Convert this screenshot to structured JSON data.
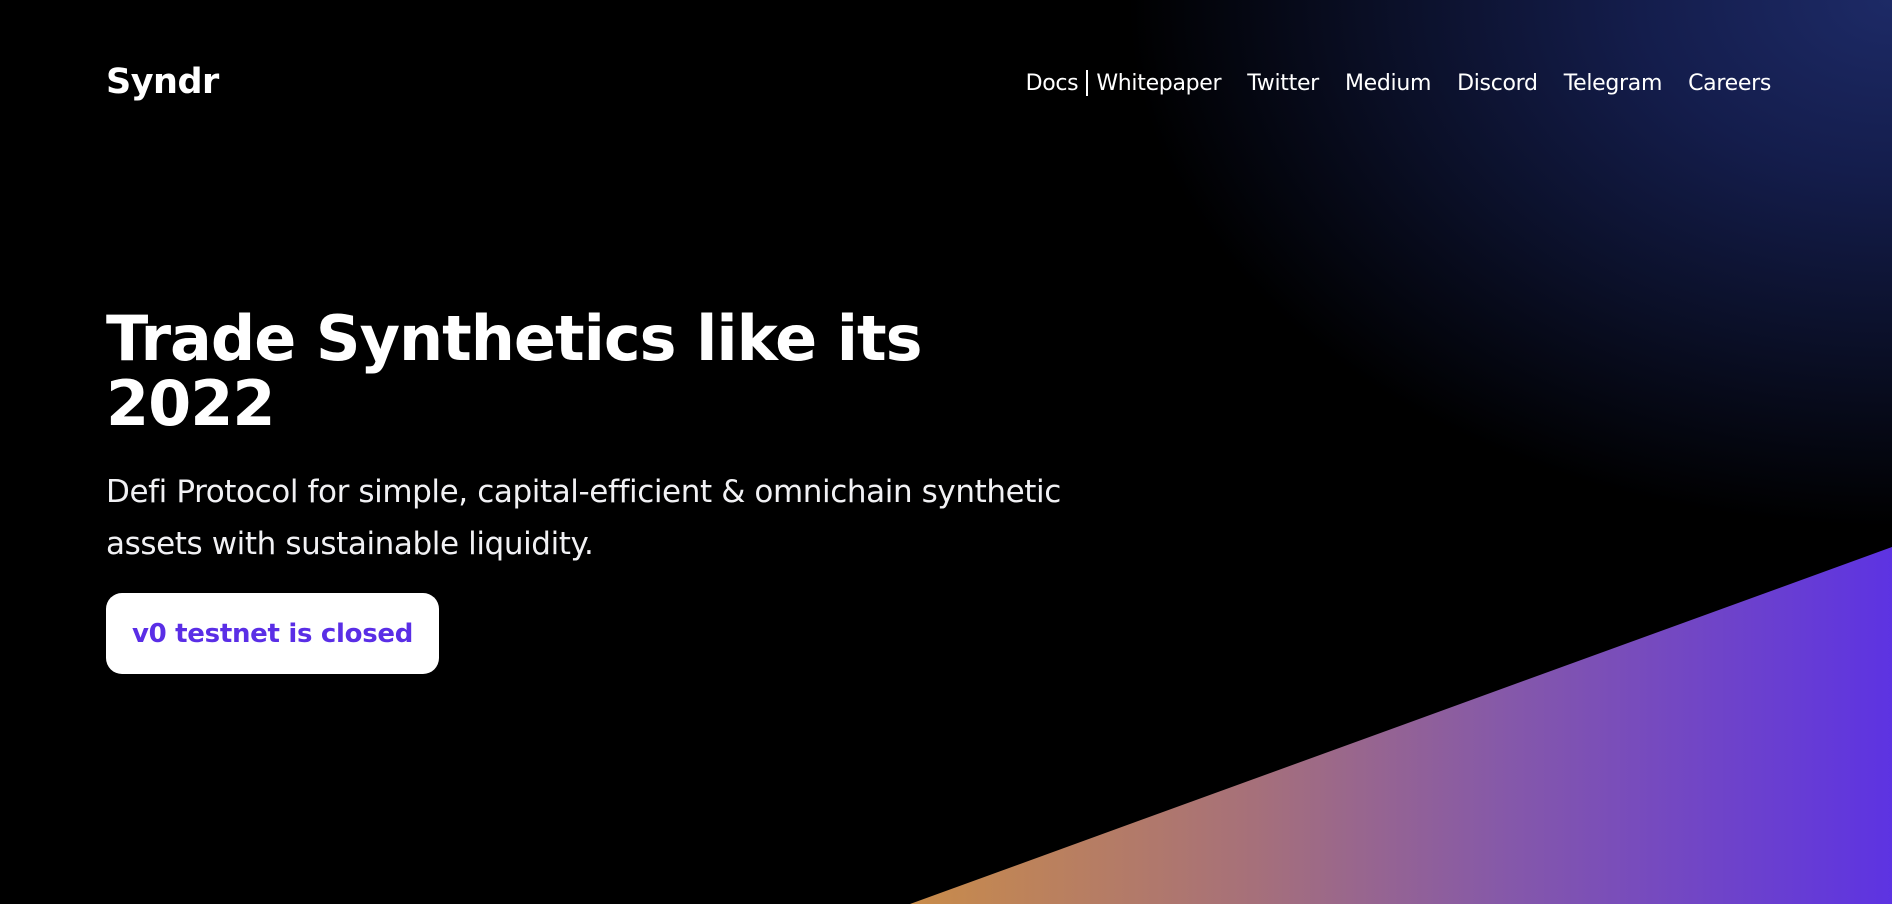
{
  "brand": {
    "name": "Syndr"
  },
  "nav": {
    "docs": "Docs",
    "whitepaper": "Whitepaper",
    "twitter": "Twitter",
    "medium": "Medium",
    "discord": "Discord",
    "telegram": "Telegram",
    "careers": "Careers"
  },
  "hero": {
    "title": "Trade Synthetics like its 2022",
    "subtitle": "Defi Protocol for simple, capital-efficient & omnichain synthetic assets with sustainable liquidity.",
    "cta_label": "v0 testnet is closed"
  },
  "colors": {
    "background": "#000000",
    "accent": "#5a2ee6",
    "wedge_start": "#c98c4a",
    "wedge_mid": "#8a5aa8",
    "wedge_end": "#5f35e0"
  }
}
